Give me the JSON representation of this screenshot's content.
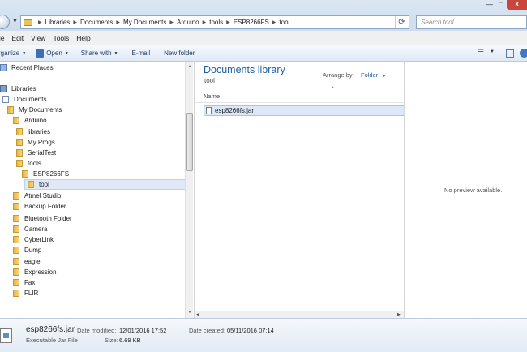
{
  "window": {
    "minimize_label": "—",
    "maximize_label": "□",
    "close_label": "X"
  },
  "address": {
    "crumbs": [
      "Libraries",
      "Documents",
      "My Documents",
      "Arduino",
      "tools",
      "ESP8266FS",
      "tool"
    ],
    "separator": "▶",
    "refresh_glyph": "⟳",
    "search_placeholder": "Search tool"
  },
  "menu": {
    "items": [
      "ile",
      "Edit",
      "View",
      "Tools",
      "Help"
    ]
  },
  "toolbar": {
    "organize": "rganize",
    "open": "Open",
    "share_with": "Share with",
    "email": "E-mail",
    "new_folder": "New folder",
    "arrow": "▼",
    "view_glyph": "☰"
  },
  "nav": {
    "items": [
      {
        "label": "Recent Places",
        "icon": "recent-places-icon"
      },
      {
        "label": "Libraries",
        "icon": "libraries-icon"
      },
      {
        "label": "Documents",
        "icon": "documents-icon"
      },
      {
        "label": "My Documents",
        "icon": "folder-icon"
      },
      {
        "label": "Arduino",
        "icon": "folder-icon"
      },
      {
        "label": "libraries",
        "icon": "folder-icon"
      },
      {
        "label": "My Progs",
        "icon": "folder-icon"
      },
      {
        "label": "SerialTest",
        "icon": "folder-icon"
      },
      {
        "label": "tools",
        "icon": "folder-icon"
      },
      {
        "label": "ESP8266FS",
        "icon": "folder-icon"
      },
      {
        "label": "tool",
        "icon": "folder-icon",
        "selected": true
      },
      {
        "label": "Atmel Studio",
        "icon": "folder-icon"
      },
      {
        "label": "Backup Folder",
        "icon": "folder-icon"
      },
      {
        "label": "Bluetooth Folder",
        "icon": "folder-icon"
      },
      {
        "label": "Camera",
        "icon": "folder-icon"
      },
      {
        "label": "CyberLink",
        "icon": "folder-icon"
      },
      {
        "label": "Dump",
        "icon": "folder-icon"
      },
      {
        "label": "eagle",
        "icon": "folder-icon"
      },
      {
        "label": "Expression",
        "icon": "folder-icon"
      },
      {
        "label": "Fax",
        "icon": "folder-icon"
      },
      {
        "label": "FLIR",
        "icon": "folder-icon"
      }
    ]
  },
  "content": {
    "title": "Documents library",
    "subtitle": "tool",
    "arrange_label": "Arrange by:",
    "arrange_value": "Folder",
    "column_name": "Name",
    "files": [
      {
        "name": "esp8266fs.jar"
      }
    ]
  },
  "preview": {
    "message": "No preview available."
  },
  "details": {
    "file_name": "esp8266fs.jar",
    "file_type": "Executable Jar File",
    "date_modified_label": "Date modified:",
    "date_modified": "12/01/2016 17:52",
    "size_label": "Size:",
    "size": "6.69 KB",
    "date_created_label": "Date created:",
    "date_created": "05/11/2016 07:14"
  }
}
